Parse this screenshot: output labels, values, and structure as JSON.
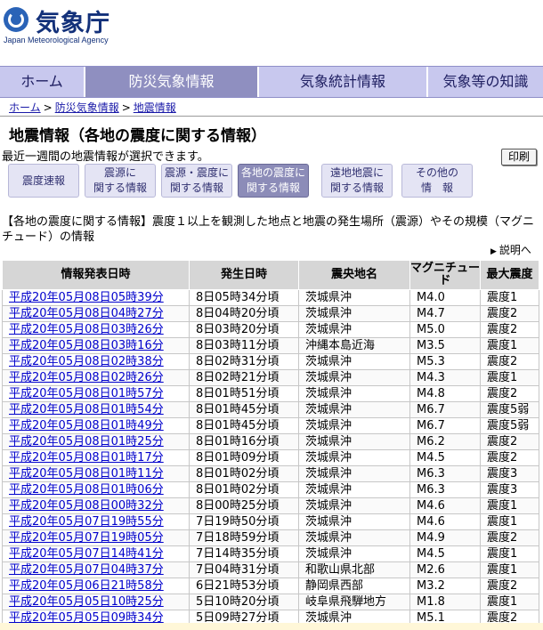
{
  "header": {
    "logo_text": "気象庁",
    "logo_sub": "Japan Meteorological Agency"
  },
  "nav": {
    "items": [
      "ホーム",
      "防災気象情報",
      "気象統計情報",
      "気象等の知識"
    ],
    "active": 1
  },
  "breadcrumb": [
    "ホーム",
    "防災気象情報",
    "地震情報"
  ],
  "page_title": "地震情報（各地の震度に関する情報）",
  "subtitle": "最近一週間の地震情報が選択できます。",
  "print_label": "印刷",
  "categories": [
    {
      "label": "震度速報",
      "active": false
    },
    {
      "label": "震源に\n関する情報",
      "active": false
    },
    {
      "label": "震源・震度に\n関する情報",
      "active": false
    },
    {
      "label": "各地の震度に\n関する情報",
      "active": true
    },
    {
      "label": "遠地地震に\n関する情報",
      "active": false
    },
    {
      "label": "その他の\n情　報",
      "active": false
    }
  ],
  "description": "【各地の震度に関する情報】震度１以上を観測した地点と地震の発生場所（震源）やその規模（マグニチュード）の情報",
  "explain_link": "説明へ",
  "chart_data": {
    "type": "table",
    "columns": [
      "情報発表日時",
      "発生日時",
      "震央地名",
      "マグニチュード",
      "最大震度"
    ],
    "rows": [
      [
        "平成20年05月08日05時39分",
        "8日05時34分頃",
        "茨城県沖",
        "M4.0",
        "震度1"
      ],
      [
        "平成20年05月08日04時27分",
        "8日04時20分頃",
        "茨城県沖",
        "M4.7",
        "震度2"
      ],
      [
        "平成20年05月08日03時26分",
        "8日03時20分頃",
        "茨城県沖",
        "M5.0",
        "震度2"
      ],
      [
        "平成20年05月08日03時16分",
        "8日03時11分頃",
        "沖縄本島近海",
        "M3.5",
        "震度1"
      ],
      [
        "平成20年05月08日02時38分",
        "8日02時31分頃",
        "茨城県沖",
        "M5.3",
        "震度2"
      ],
      [
        "平成20年05月08日02時26分",
        "8日02時21分頃",
        "茨城県沖",
        "M4.3",
        "震度1"
      ],
      [
        "平成20年05月08日01時57分",
        "8日01時51分頃",
        "茨城県沖",
        "M4.8",
        "震度2"
      ],
      [
        "平成20年05月08日01時54分",
        "8日01時45分頃",
        "茨城県沖",
        "M6.7",
        "震度5弱"
      ],
      [
        "平成20年05月08日01時49分",
        "8日01時45分頃",
        "茨城県沖",
        "M6.7",
        "震度5弱"
      ],
      [
        "平成20年05月08日01時25分",
        "8日01時16分頃",
        "茨城県沖",
        "M6.2",
        "震度2"
      ],
      [
        "平成20年05月08日01時17分",
        "8日01時09分頃",
        "茨城県沖",
        "M4.5",
        "震度2"
      ],
      [
        "平成20年05月08日01時11分",
        "8日01時02分頃",
        "茨城県沖",
        "M6.3",
        "震度3"
      ],
      [
        "平成20年05月08日01時06分",
        "8日01時02分頃",
        "茨城県沖",
        "M6.3",
        "震度3"
      ],
      [
        "平成20年05月08日00時32分",
        "8日00時25分頃",
        "茨城県沖",
        "M4.6",
        "震度1"
      ],
      [
        "平成20年05月07日19時55分",
        "7日19時50分頃",
        "茨城県沖",
        "M4.6",
        "震度1"
      ],
      [
        "平成20年05月07日19時05分",
        "7日18時59分頃",
        "茨城県沖",
        "M4.9",
        "震度2"
      ],
      [
        "平成20年05月07日14時41分",
        "7日14時35分頃",
        "茨城県沖",
        "M4.5",
        "震度1"
      ],
      [
        "平成20年05月07日04時37分",
        "7日04時31分頃",
        "和歌山県北部",
        "M2.6",
        "震度1"
      ],
      [
        "平成20年05月06日21時58分",
        "6日21時53分頃",
        "静岡県西部",
        "M3.2",
        "震度2"
      ],
      [
        "平成20年05月05日10時25分",
        "5日10時20分頃",
        "岐阜県飛騨地方",
        "M1.8",
        "震度1"
      ],
      [
        "平成20年05月05日09時34分",
        "5日09時27分頃",
        "茨城県沖",
        "M5.1",
        "震度2"
      ]
    ]
  }
}
